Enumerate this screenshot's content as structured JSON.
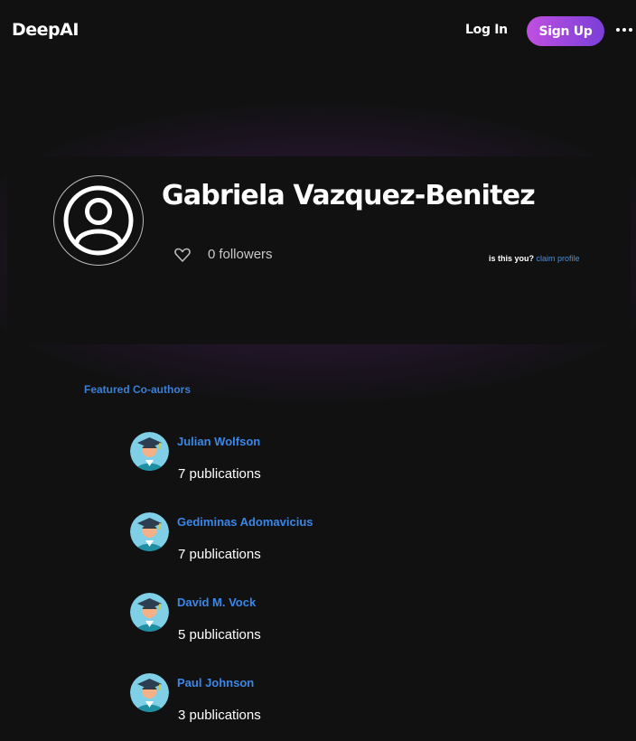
{
  "header": {
    "logo": "DeepAI",
    "login_label": "Log In",
    "signup_label": "Sign Up",
    "more_icon": "more-dots-icon"
  },
  "profile": {
    "name": "Gabriela Vazquez-Benitez",
    "avatar_icon": "user-circle-icon",
    "follow_icon": "heart-icon",
    "followers_count": "0",
    "followers_label": "followers",
    "claim_question": "is this you?",
    "claim_link": "claim profile"
  },
  "coauthors": {
    "title": "Featured Co-authors",
    "items": [
      {
        "name": "Julian Wolfson",
        "publications": "7 publications"
      },
      {
        "name": "Gediminas Adomavicius",
        "publications": "7 publications"
      },
      {
        "name": "David M. Vock",
        "publications": "5 publications"
      },
      {
        "name": "Paul Johnson",
        "publications": "3 publications"
      }
    ]
  },
  "colors": {
    "background": "#111111",
    "accent_link": "#3b87e8",
    "signup_gradient_start": "#c04fe0",
    "signup_gradient_end": "#7a3fd8"
  }
}
